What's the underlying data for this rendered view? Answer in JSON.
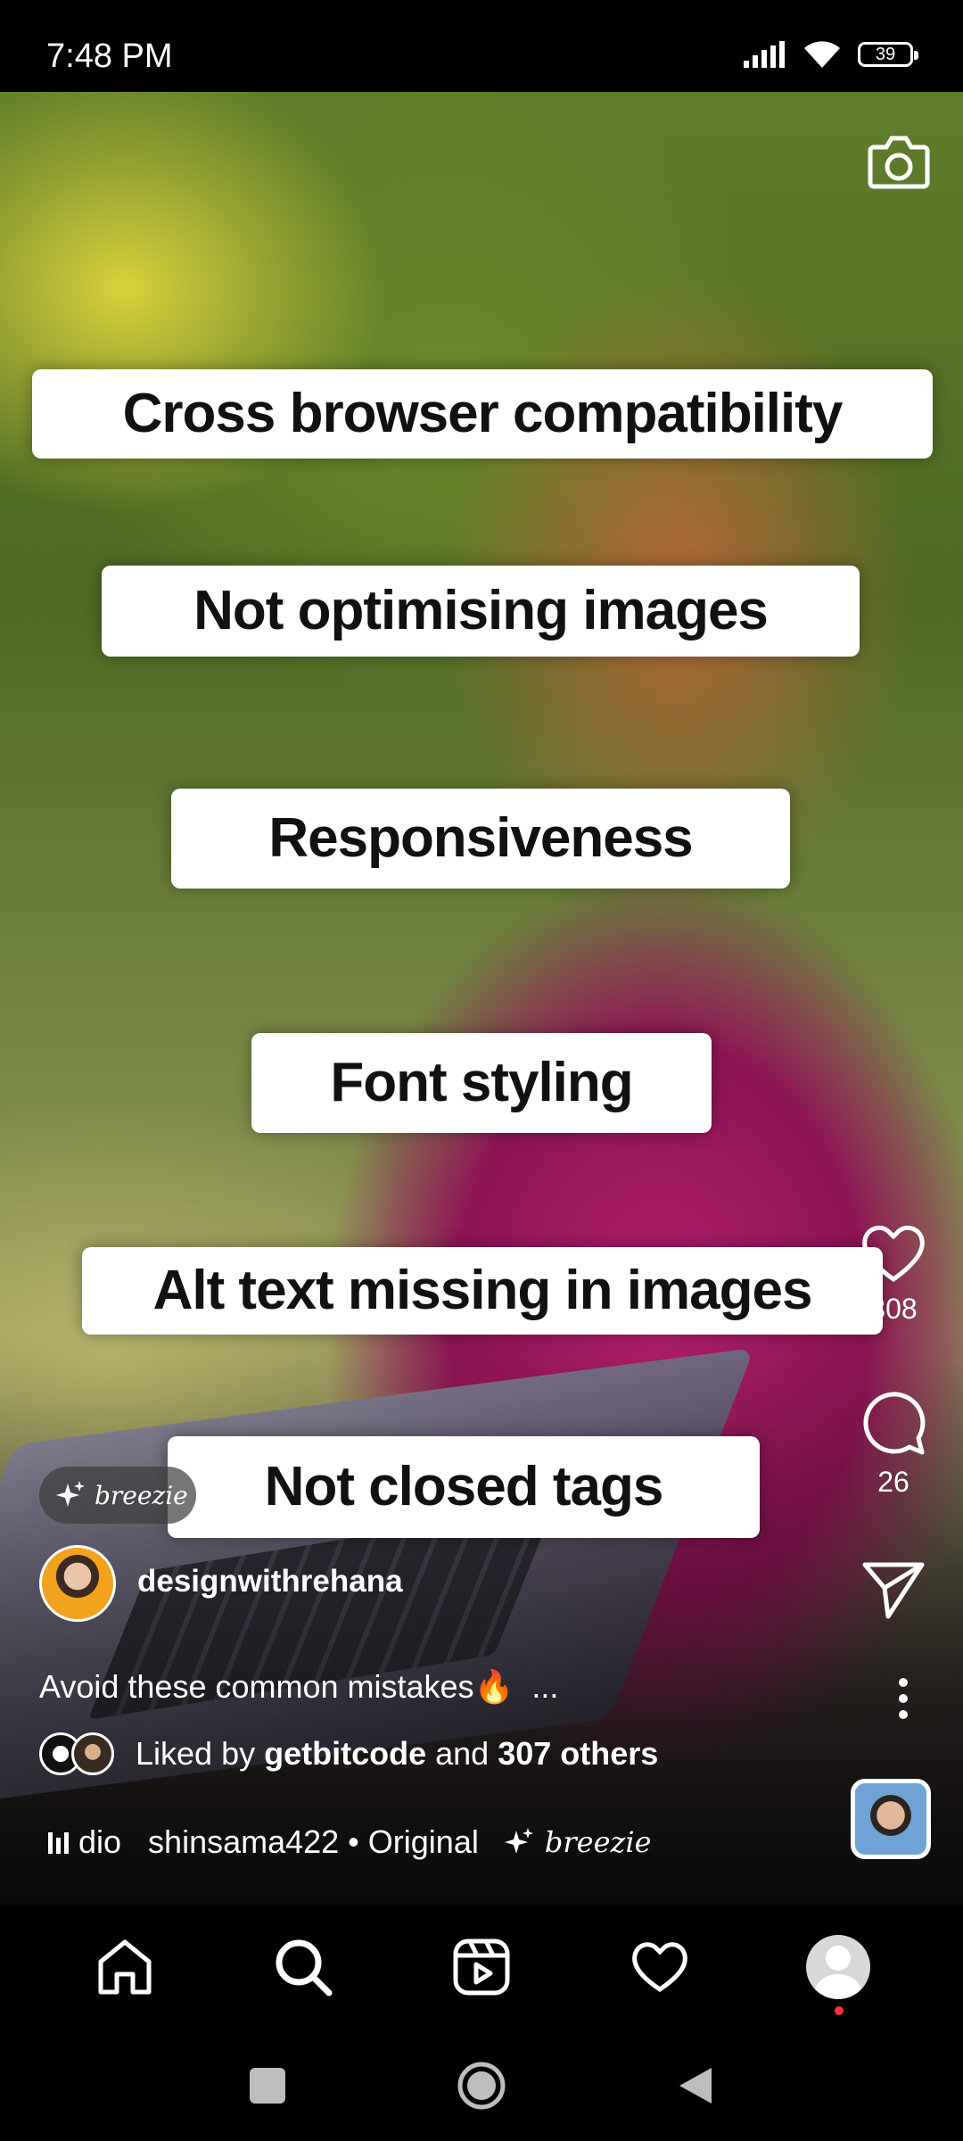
{
  "status_bar": {
    "time": "7:48 PM",
    "battery": "39"
  },
  "overlays": [
    "Cross browser compatibility",
    "Not optimising images",
    "Responsiveness",
    "Font styling",
    "Alt text missing in images",
    "Not closed tags"
  ],
  "effect_tag": "breezie",
  "reel": {
    "username": "designwithrehana",
    "caption": "Avoid these common mistakes🔥",
    "caption_more": "...",
    "likes_count": "308",
    "comments_count": "26",
    "liked_by": {
      "prefix": "Liked by",
      "user": "getbitcode",
      "middle": "and",
      "others": "307 others"
    },
    "audio": {
      "scroll_text": "dio",
      "track": "shinsama422 • Original",
      "effect": "breezie"
    }
  },
  "icons": [
    "camera-icon",
    "heart-icon",
    "comment-icon",
    "share-icon",
    "more-icon",
    "home-icon",
    "search-icon",
    "reels-icon",
    "activity-icon",
    "profile-avatar",
    "audio-bars-icon",
    "sparkle-icon"
  ],
  "colors": {
    "accent_dot": "#ff3040",
    "sweater": "#b01e6a"
  }
}
